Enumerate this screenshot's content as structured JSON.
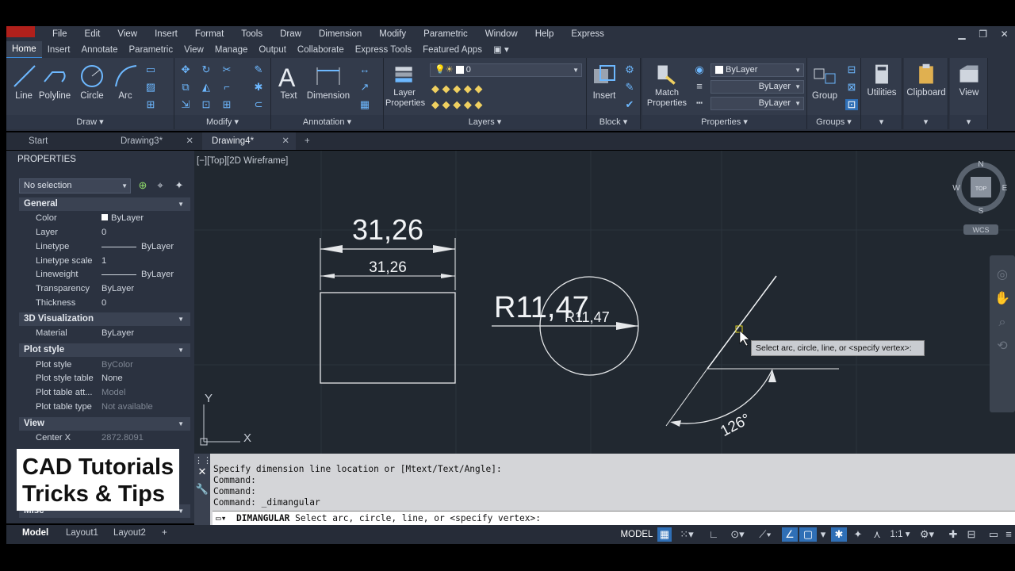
{
  "menu": [
    "File",
    "Edit",
    "View",
    "Insert",
    "Format",
    "Tools",
    "Draw",
    "Dimension",
    "Modify",
    "Parametric",
    "Window",
    "Help",
    "Express"
  ],
  "ribbon_tabs": [
    "Home",
    "Insert",
    "Annotate",
    "Parametric",
    "View",
    "Manage",
    "Output",
    "Collaborate",
    "Express Tools",
    "Featured Apps"
  ],
  "draw_panel": {
    "title": "Draw",
    "tools": [
      "Line",
      "Polyline",
      "Circle",
      "Arc"
    ]
  },
  "modify_panel": {
    "title": "Modify"
  },
  "annotation_panel": {
    "title": "Annotation",
    "tools": [
      "Text",
      "Dimension"
    ]
  },
  "layers_panel": {
    "title": "Layers",
    "layer_props": "Layer Properties",
    "current_layer": "0"
  },
  "block_panel": {
    "title": "Block",
    "insert": "Insert"
  },
  "properties_panel": {
    "title": "Properties",
    "match": "Match Properties",
    "color": "ByLayer",
    "linetype": "ByLayer",
    "lineweight": "ByLayer"
  },
  "groups_panel": {
    "title": "Groups",
    "group": "Group"
  },
  "extra_tools": [
    "Utilities",
    "Clipboard",
    "View"
  ],
  "doc_tabs": [
    {
      "label": "Start"
    },
    {
      "label": "Drawing3*"
    },
    {
      "label": "Drawing4*"
    }
  ],
  "viewport_label": "[−][Top][2D Wireframe]",
  "properties_palette": {
    "title": "PROPERTIES",
    "selection": "No selection",
    "sections": {
      "general": "General",
      "viz": "3D Visualization",
      "plot": "Plot style",
      "view": "View",
      "misc": "Misc"
    },
    "general": [
      {
        "k": "Color",
        "v": "ByLayer"
      },
      {
        "k": "Layer",
        "v": "0"
      },
      {
        "k": "Linetype",
        "v": "ByLayer"
      },
      {
        "k": "Linetype scale",
        "v": "1"
      },
      {
        "k": "Lineweight",
        "v": "ByLayer"
      },
      {
        "k": "Transparency",
        "v": "ByLayer"
      },
      {
        "k": "Thickness",
        "v": "0"
      }
    ],
    "viz": [
      {
        "k": "Material",
        "v": "ByLayer"
      }
    ],
    "plot": [
      {
        "k": "Plot style",
        "v": "ByColor"
      },
      {
        "k": "Plot style table",
        "v": "None"
      },
      {
        "k": "Plot table att...",
        "v": "Model"
      },
      {
        "k": "Plot table type",
        "v": "Not available"
      }
    ],
    "view": [
      {
        "k": "Center X",
        "v": "2872.8091"
      }
    ]
  },
  "badge": {
    "line1": "CAD Tutorials",
    "line2": "Tricks & Tips"
  },
  "drawing": {
    "dim_large": "31,26",
    "dim_small": "31,26",
    "radius_large": "R11,47",
    "radius_small": "R11,47",
    "angle": "126°",
    "tooltip": "Select arc, circle, line, or <specify vertex>:",
    "ucs_x": "X",
    "ucs_y": "Y"
  },
  "viewcube": {
    "n": "N",
    "s": "S",
    "e": "E",
    "w": "W",
    "face": "TOP",
    "wcs": "WCS"
  },
  "command": {
    "history": [
      "Specify dimension line location or [Mtext/Text/Angle]:",
      "Command:",
      "Command:",
      "Command: _dimangular"
    ],
    "prompt_cmd": "DIMANGULAR",
    "prompt_text": " Select arc, circle, line, or <specify vertex>:"
  },
  "layout_tabs": [
    "Model",
    "Layout1",
    "Layout2"
  ],
  "status": {
    "model": "MODEL",
    "scale": "1:1"
  }
}
